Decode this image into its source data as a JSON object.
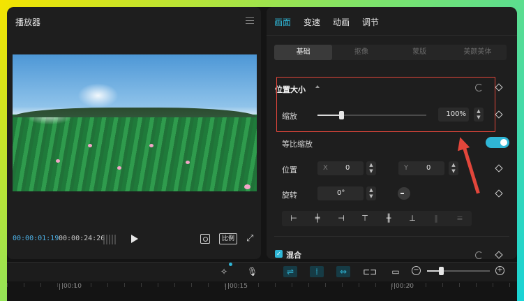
{
  "player": {
    "title": "播放器",
    "time_current": "00:00:01:19",
    "time_total": "00:00:24:26",
    "ratio_label": "比例"
  },
  "props": {
    "tabs": [
      {
        "label": "画面",
        "active": true
      },
      {
        "label": "变速",
        "active": false
      },
      {
        "label": "动画",
        "active": false
      },
      {
        "label": "调节",
        "active": false
      }
    ],
    "subtabs": [
      {
        "label": "基础",
        "active": true
      },
      {
        "label": "抠像",
        "active": false
      },
      {
        "label": "蒙版",
        "active": false
      },
      {
        "label": "美颜美体",
        "active": false
      }
    ],
    "position_size": {
      "title": "位置大小",
      "scale_label": "缩放",
      "scale_value": "100%",
      "scale_fraction": 0.22
    },
    "uniform_scale_label": "等比缩放",
    "uniform_scale_on": true,
    "position": {
      "label": "位置",
      "x_axis": "X",
      "x_value": "0",
      "y_axis": "Y",
      "y_value": "0"
    },
    "rotation": {
      "label": "旋转",
      "value": "0°"
    },
    "align_icons": [
      "align-left",
      "align-center-h",
      "align-right",
      "align-top",
      "align-center-v",
      "align-bottom",
      "distribute-h",
      "distribute-v"
    ],
    "blend_label": "混合"
  },
  "timeline": {
    "ticks": [
      "|00:10",
      "|00:15",
      "|00:20"
    ],
    "zoom_fraction": 0.22
  },
  "colors": {
    "accent": "#2fb6d6",
    "highlight_red": "#e2463b"
  }
}
